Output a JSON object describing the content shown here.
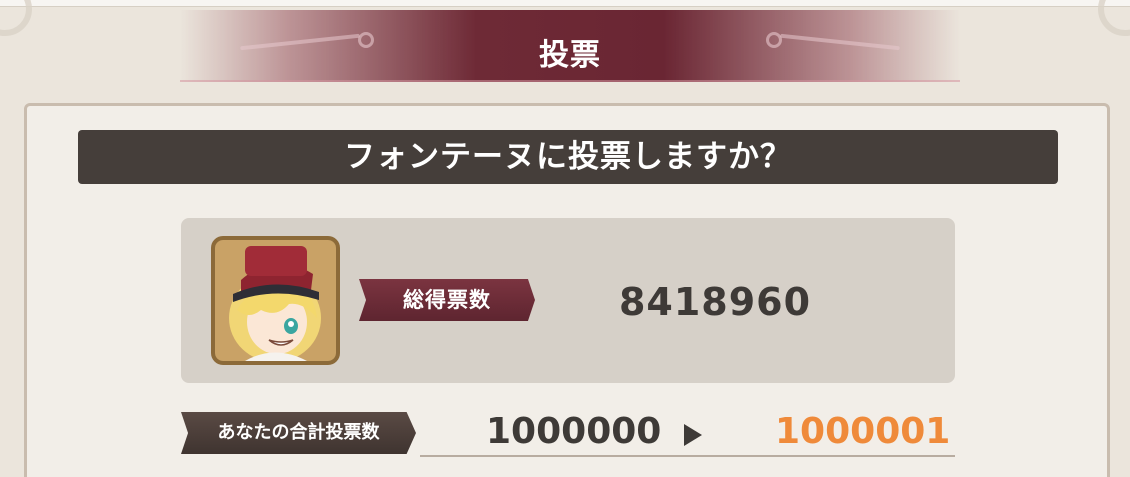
{
  "dialog": {
    "title": "投票",
    "question": "フォンテーヌに投票しますか？"
  },
  "candidate": {
    "avatar_icon": "character-portrait-icon",
    "total_votes_label": "総得票数",
    "total_votes_value": "8418960"
  },
  "my_votes": {
    "label": "あなたの合計投票数",
    "current_value": "1000000",
    "next_value": "1000001",
    "arrow_icon": "play-arrow-icon"
  },
  "colors": {
    "title_banner": "#6e2a36",
    "question_bar": "#453e3a",
    "next_value": "#ef8a3a",
    "label_badge": "#6a2c37"
  }
}
